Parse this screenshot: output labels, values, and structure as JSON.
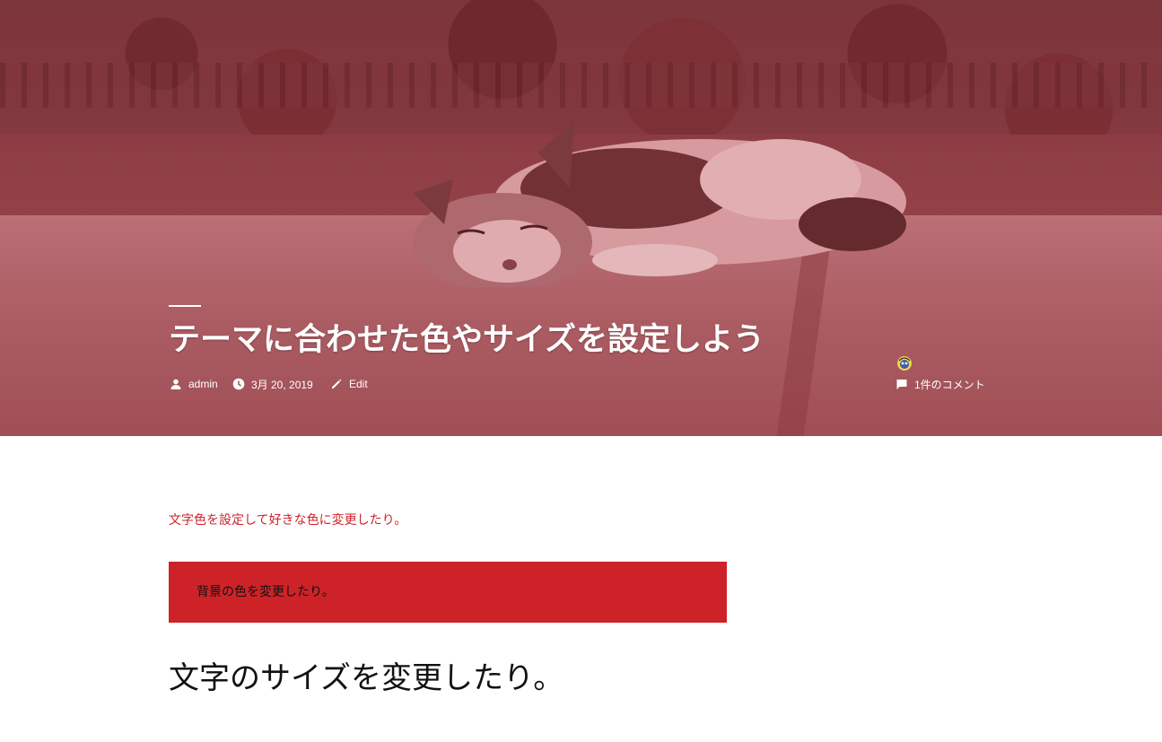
{
  "post": {
    "title": "テーマに合わせた色やサイズを設定しよう",
    "author_label": "admin",
    "date_label": "3月 20, 2019",
    "edit_label": "Edit",
    "comments_label": "1件のコメント"
  },
  "icons": {
    "author": "person-icon",
    "date": "clock-icon",
    "edit": "pencil-icon",
    "comments": "comment-icon",
    "avatar": "avatar-icon"
  },
  "content": {
    "red_paragraph": "文字色を設定して好きな色に変更したり。",
    "box_paragraph": "背景の色を変更したり。",
    "large_paragraph": "文字のサイズを変更したり。"
  },
  "colors": {
    "accent": "#cd2328",
    "hero_tint": "#8e4b52",
    "text": "#111111",
    "background": "#ffffff"
  }
}
